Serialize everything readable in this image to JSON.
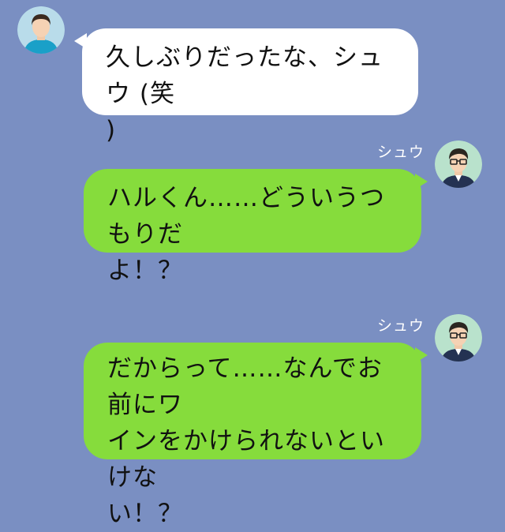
{
  "messages": [
    {
      "side": "left",
      "text": "久しぶりだったな、シュウ (笑)",
      "avatar": "user-avatar-haru"
    },
    {
      "side": "right",
      "sender": "シュウ",
      "text": "ハルくん……どういうつもりだよ！？",
      "avatar": "user-avatar-shu"
    },
    {
      "side": "right",
      "sender": "シュウ",
      "text": "だからって……なんでお前にワインをかけられないといけない！？",
      "avatar": "user-avatar-shu"
    }
  ],
  "display": {
    "m1_line1": "久しぶりだったな、シュウ (笑",
    "m1_line2": ")",
    "m2_line1": "ハルくん……どういうつもりだ",
    "m2_line2": "よ！？",
    "m3_line1": "だからって……なんでお前にワ",
    "m3_line2": "インをかけられないといけな",
    "m3_line3": "い！？"
  },
  "colors": {
    "background": "#7a8fc2",
    "incoming_bubble": "#ffffff",
    "outgoing_bubble": "#86dc3c"
  }
}
